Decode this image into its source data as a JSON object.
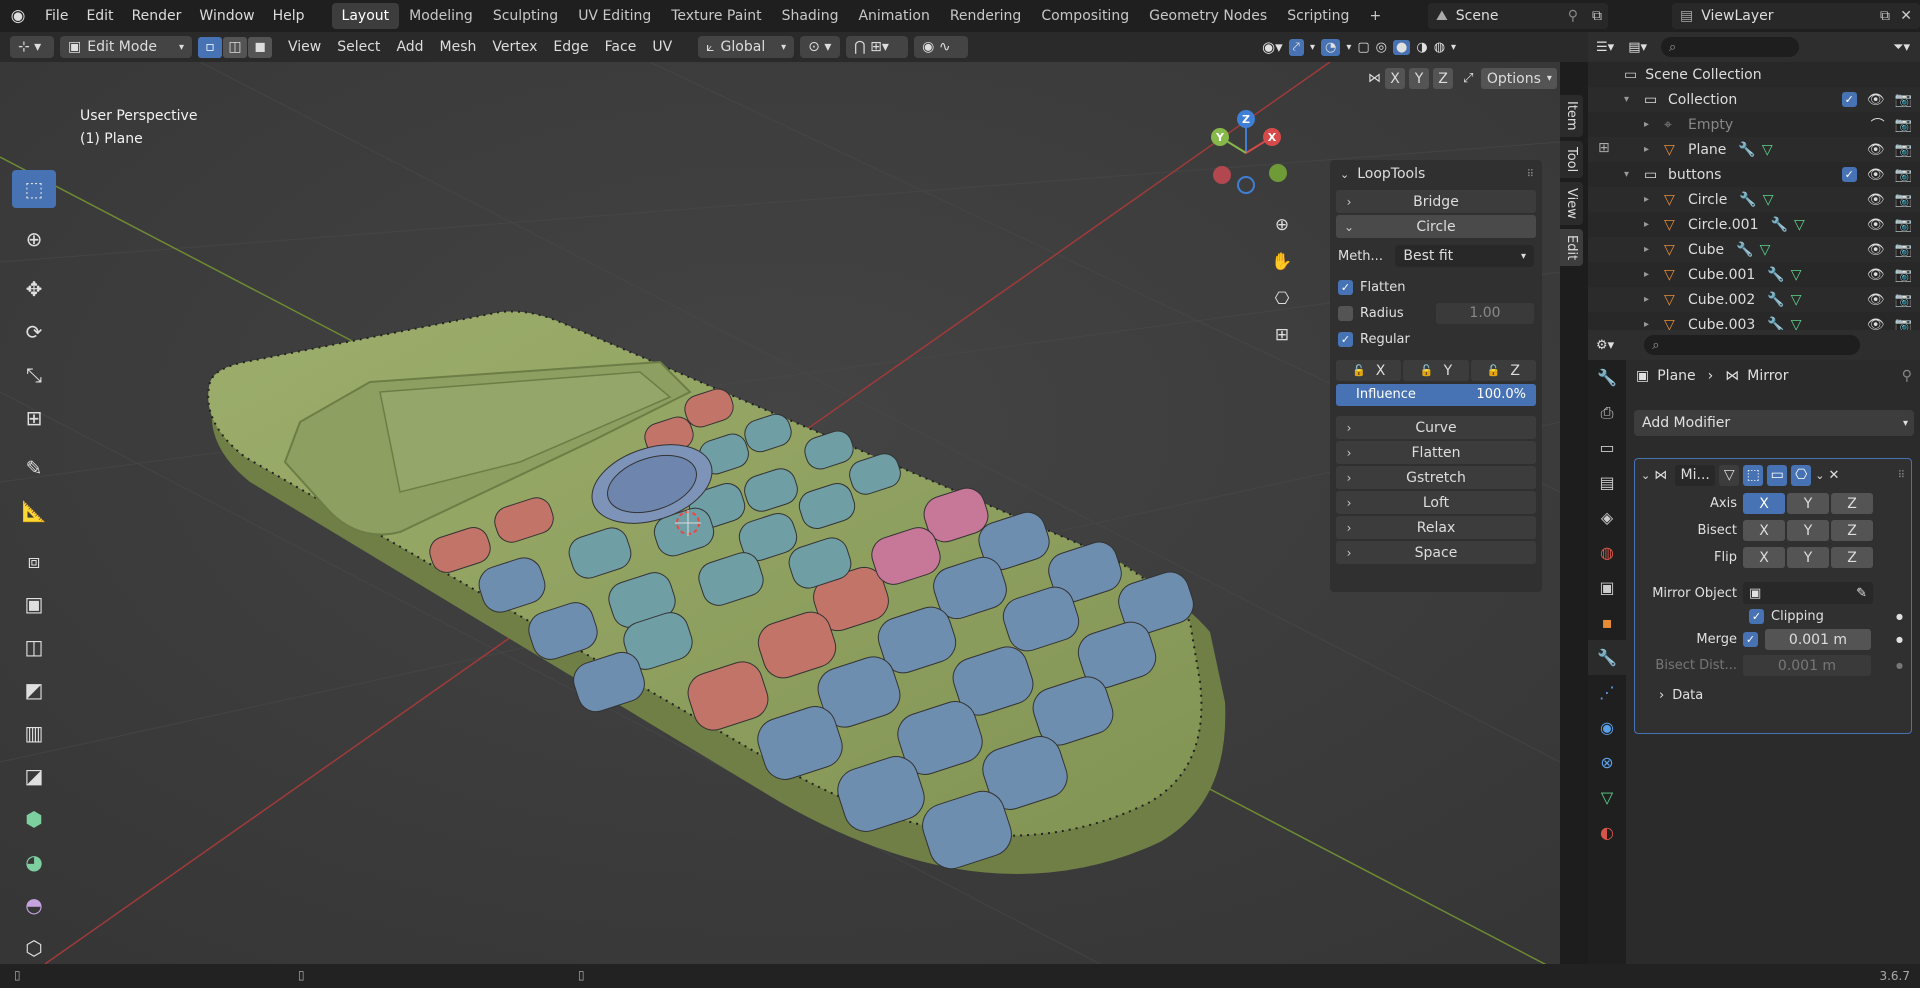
{
  "menubar": {
    "items": [
      "File",
      "Edit",
      "Render",
      "Window",
      "Help"
    ]
  },
  "workspaces": {
    "tabs": [
      "Layout",
      "Modeling",
      "Sculpting",
      "UV Editing",
      "Texture Paint",
      "Shading",
      "Animation",
      "Rendering",
      "Compositing",
      "Geometry Nodes",
      "Scripting"
    ],
    "add": "+"
  },
  "scene": {
    "name": "Scene",
    "view_layer": "ViewLayer"
  },
  "viewport_header": {
    "mode": "Edit Mode",
    "menus": [
      "View",
      "Select",
      "Add",
      "Mesh",
      "Vertex",
      "Edge",
      "Face",
      "UV"
    ],
    "orientation": "Global",
    "axis_x": "X",
    "axis_y": "Y",
    "axis_z": "Z",
    "options": "Options"
  },
  "viewport": {
    "perspective": "User Perspective",
    "object": "(1) Plane"
  },
  "gizmo": {
    "x": "X",
    "y": "Y",
    "z": "Z"
  },
  "looptools": {
    "title": "LoopTools",
    "items_top": [
      "Bridge",
      "Circle"
    ],
    "method_label": "Meth...",
    "method_value": "Best fit",
    "flatten": "Flatten",
    "radius": "Radius",
    "radius_value": "1.00",
    "regular": "Regular",
    "lock_x": "X",
    "lock_y": "Y",
    "lock_z": "Z",
    "influence": "Influence",
    "influence_value": "100.0%",
    "influence_fraction": 1.0,
    "items_bottom": [
      "Curve",
      "Flatten",
      "Gstretch",
      "Loft",
      "Relax",
      "Space"
    ]
  },
  "side_tabs": [
    "Item",
    "Tool",
    "View",
    "Edit"
  ],
  "outliner": {
    "scene_collection": "Scene Collection",
    "rows": [
      {
        "name": "Collection",
        "kind": "collection",
        "indent": 1
      },
      {
        "name": "Empty",
        "kind": "empty",
        "indent": 2
      },
      {
        "name": "Plane",
        "kind": "mesh",
        "indent": 2
      },
      {
        "name": "buttons",
        "kind": "collection",
        "indent": 1
      },
      {
        "name": "Circle",
        "kind": "mesh",
        "indent": 2
      },
      {
        "name": "Circle.001",
        "kind": "mesh",
        "indent": 2
      },
      {
        "name": "Cube",
        "kind": "mesh",
        "indent": 2
      },
      {
        "name": "Cube.001",
        "kind": "mesh",
        "indent": 2
      },
      {
        "name": "Cube.002",
        "kind": "mesh",
        "indent": 2
      },
      {
        "name": "Cube.003",
        "kind": "mesh",
        "indent": 2
      }
    ]
  },
  "properties": {
    "breadcrumb_object": "Plane",
    "breadcrumb_modifier": "Mirror",
    "add_modifier": "Add Modifier",
    "modifier_name": "Mi...",
    "axis_label": "Axis",
    "bisect_label": "Bisect",
    "flip_label": "Flip",
    "x": "X",
    "y": "Y",
    "z": "Z",
    "mirror_object_label": "Mirror Object",
    "clipping": "Clipping",
    "merge_label": "Merge",
    "merge_value": "0.001 m",
    "bisect_dist_label": "Bisect Dist...",
    "bisect_dist_value": "0.001 m",
    "data": "Data"
  },
  "status": {
    "version": "3.6.7"
  },
  "colors": {
    "accent": "#4772b3",
    "body": "#8fa160",
    "key_blue": "#6e8eb0",
    "key_red": "#c27468",
    "key_pink": "#c77898",
    "key_teal": "#6f9ea5"
  }
}
